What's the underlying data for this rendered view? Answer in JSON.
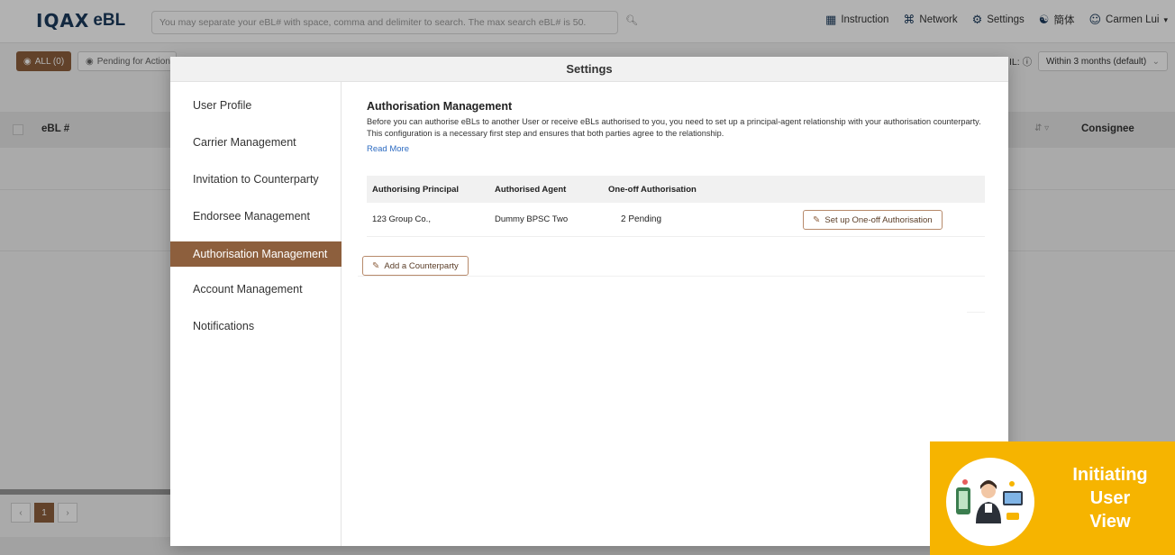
{
  "header": {
    "logo_mark": "IQAX",
    "logo_text": "eBL",
    "search_placeholder": "You may separate your eBL# with space, comma and delimiter to search. The max search eBL# is 50.",
    "nav": [
      {
        "label": "Instruction",
        "icon": "book-icon"
      },
      {
        "label": "Network",
        "icon": "network-icon"
      },
      {
        "label": "Settings",
        "icon": "gear-icon"
      },
      {
        "label": "簡体",
        "icon": "globe-icon"
      },
      {
        "label": "Carmen Lui",
        "icon": "user-icon"
      }
    ]
  },
  "filters": {
    "all_label": "ALL (0)",
    "pending_label": "Pending for Action",
    "range_label": "IL: ⓘ",
    "range_value": "Within 3 months (default)"
  },
  "table": {
    "col_ebl": "eBL #",
    "col_consignee": "Consignee",
    "page": "1"
  },
  "modal": {
    "title": "Settings",
    "menu": [
      "User Profile",
      "Carrier Management",
      "Invitation to Counterparty",
      "Endorsee Management",
      "Authorisation Management",
      "Account Management",
      "Notifications"
    ],
    "active_menu": "Authorisation Management",
    "section_title": "Authorisation Management",
    "description": "Before you can authorise eBLs to another User or receive eBLs authorised to you, you need to set up a principal-agent relationship with your authorisation counterparty. This configuration is a necessary first step and ensures that both parties agree to the relationship.",
    "read_more": "Read More",
    "columns": [
      "Authorising Principal",
      "Authorised Agent",
      "One-off Authorisation"
    ],
    "rows": [
      {
        "principal": "123 Group Co.,",
        "agent": "Dummy BPSC Two",
        "one_off": "2 Pending",
        "action": "Set up One-off Authorisation"
      }
    ],
    "add_button": "Add a Counterparty"
  },
  "badge": {
    "line1": "Initiating",
    "line2": "User",
    "line3": "View"
  },
  "colors": {
    "accent": "#8d5f3d",
    "badge": "#f6b400",
    "link": "#2e6cc2"
  }
}
